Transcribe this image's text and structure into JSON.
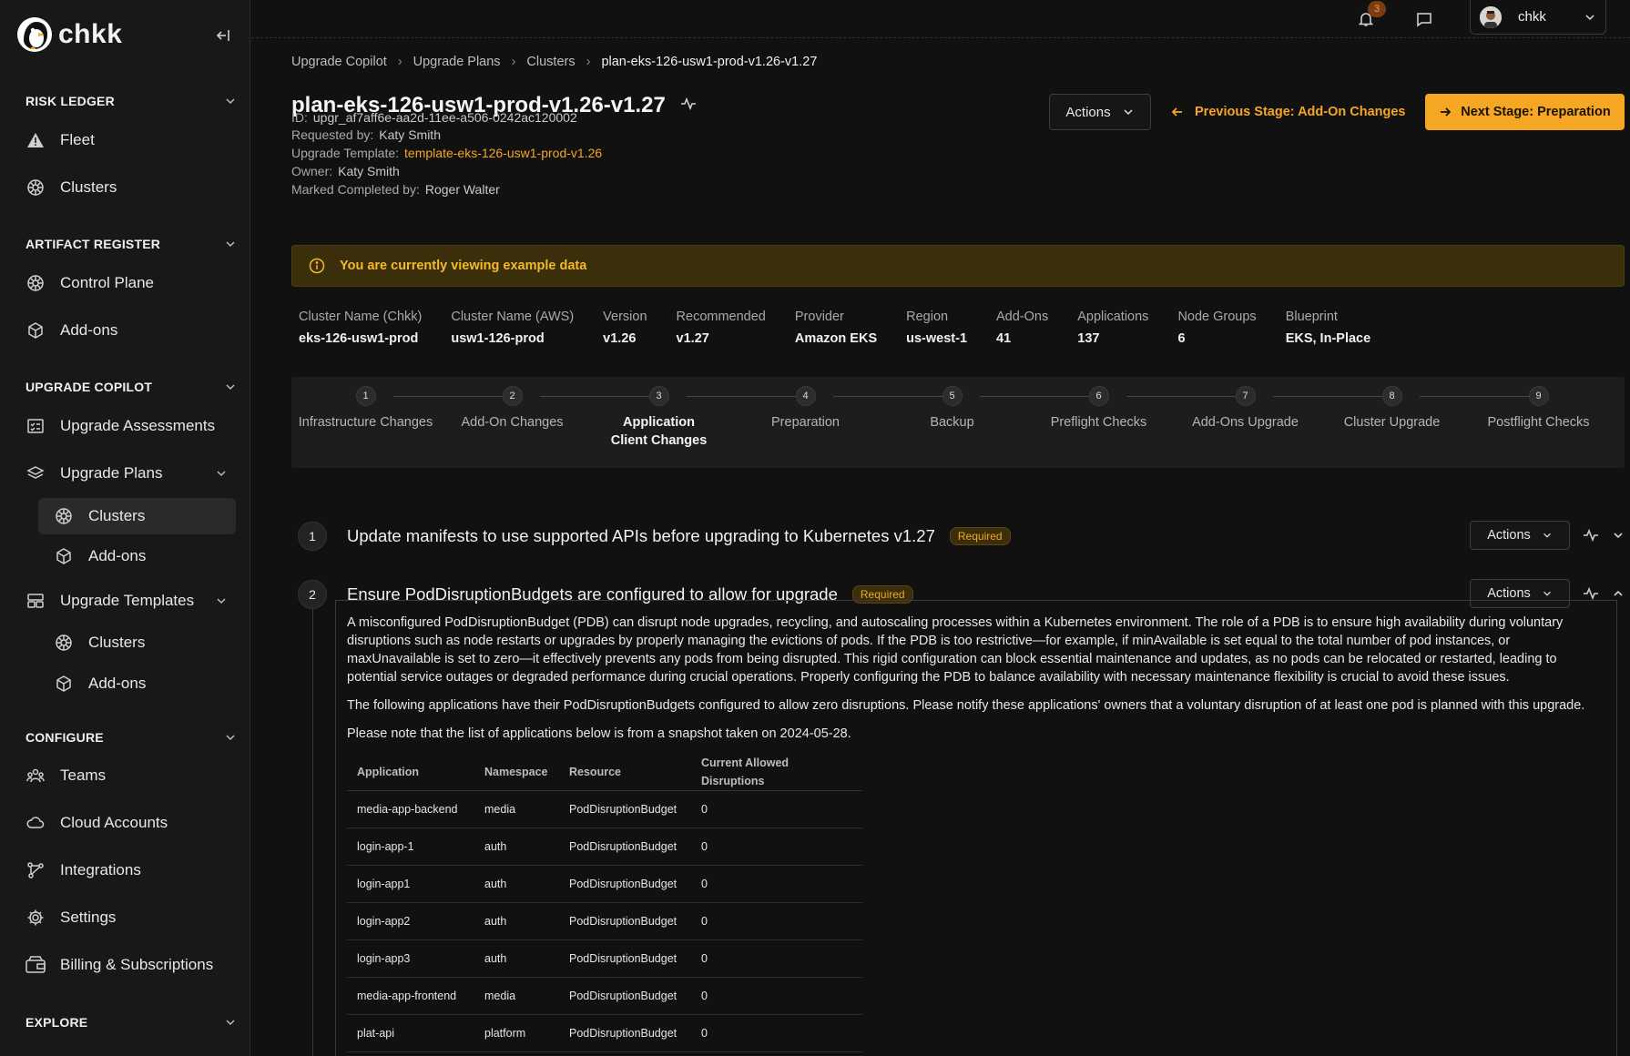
{
  "app": {
    "logo_text": "chkk"
  },
  "sidebar": {
    "sections": {
      "risk_ledger": "RISK LEDGER",
      "artifact_register": "ARTIFACT REGISTER",
      "upgrade_copilot": "UPGRADE COPILOT",
      "configure": "CONFIGURE",
      "explore": "EXPLORE"
    },
    "items": {
      "fleet": "Fleet",
      "clusters": "Clusters",
      "control_plane": "Control Plane",
      "addons": "Add-ons",
      "upgrade_assessments": "Upgrade Assessments",
      "upgrade_plans": "Upgrade Plans",
      "plans_clusters": "Clusters",
      "plans_addons": "Add-ons",
      "upgrade_templates": "Upgrade Templates",
      "templates_clusters": "Clusters",
      "templates_addons": "Add-ons",
      "teams": "Teams",
      "cloud_accounts": "Cloud Accounts",
      "integrations": "Integrations",
      "settings": "Settings",
      "billing": "Billing & Subscriptions"
    }
  },
  "topbar": {
    "notification_count": "3",
    "user_name": "chkk"
  },
  "breadcrumb": [
    "Upgrade Copilot",
    "Upgrade Plans",
    "Clusters",
    "plan-eks-126-usw1-prod-v1.26-v1.27"
  ],
  "page": {
    "title": "plan-eks-126-usw1-prod-v1.26-v1.27",
    "id_label": "ID:",
    "id_value": "upgr_af7aff6e-aa2d-11ee-a506-0242ac120002",
    "requested_label": "Requested by:",
    "requested_value": "Katy Smith",
    "template_label": "Upgrade Template:",
    "template_value": "template-eks-126-usw1-prod-v1.26",
    "owner_label": "Owner:",
    "owner_value": "Katy Smith",
    "completed_label": "Marked Completed by:",
    "completed_value": "Roger Walter",
    "actions_label": "Actions",
    "prev_stage": "Previous Stage: Add-On Changes",
    "next_stage": "Next Stage: Preparation"
  },
  "banner": {
    "text": "You are currently viewing example data"
  },
  "stats": [
    {
      "key": "Cluster Name (Chkk)",
      "value": "eks-126-usw1-prod"
    },
    {
      "key": "Cluster Name (AWS)",
      "value": "usw1-126-prod"
    },
    {
      "key": "Version",
      "value": "v1.26"
    },
    {
      "key": "Recommended",
      "value": "v1.27"
    },
    {
      "key": "Provider",
      "value": "Amazon EKS"
    },
    {
      "key": "Region",
      "value": "us-west-1"
    },
    {
      "key": "Add-Ons",
      "value": "41"
    },
    {
      "key": "Applications",
      "value": "137"
    },
    {
      "key": "Node Groups",
      "value": "6"
    },
    {
      "key": "Blueprint",
      "value": "EKS, In-Place"
    }
  ],
  "steps": [
    {
      "num": "1",
      "label": "Infrastructure Changes"
    },
    {
      "num": "2",
      "label": "Add-On Changes"
    },
    {
      "num": "3",
      "label": "Application Client Changes"
    },
    {
      "num": "4",
      "label": "Preparation"
    },
    {
      "num": "5",
      "label": "Backup"
    },
    {
      "num": "6",
      "label": "Preflight Checks"
    },
    {
      "num": "7",
      "label": "Add-Ons Upgrade"
    },
    {
      "num": "8",
      "label": "Cluster Upgrade"
    },
    {
      "num": "9",
      "label": "Postflight Checks"
    }
  ],
  "tasks": [
    {
      "num": "1",
      "title": "Update manifests to use supported APIs before upgrading to Kubernetes v1.27",
      "badge": "Required",
      "actions": "Actions"
    },
    {
      "num": "2",
      "title": "Ensure PodDisruptionBudgets are configured to allow for upgrade",
      "badge": "Required",
      "actions": "Actions"
    }
  ],
  "detail": {
    "p1": "A misconfigured PodDisruptionBudget (PDB) can disrupt node upgrades, recycling, and autoscaling processes within a Kubernetes environment. The role of a PDB is to ensure high availability during voluntary disruptions such as node restarts or upgrades by properly managing the evictions of pods. If the PDB is too restrictive—for example, if minAvailable is set equal to the total number of pod instances, or maxUnavailable is set to zero—it effectively prevents any pods from being disrupted. This rigid configuration can block essential maintenance and updates, as no pods can be relocated or restarted, leading to potential service outages or degraded performance during crucial operations. Properly configuring the PDB to balance availability with necessary maintenance flexibility is crucial to avoid these issues.",
    "p2": "The following applications have their PodDisruptionBudgets configured to allow zero disruptions. Please notify these applications' owners that a voluntary disruption of at least one pod is planned with this upgrade.",
    "p3": "Please note that the list of applications below is from a snapshot taken on 2024-05-28.",
    "table": {
      "headers": [
        "Application",
        "Namespace",
        "Resource",
        "Current Allowed Disruptions"
      ],
      "rows": [
        [
          "media-app-backend",
          "media",
          "PodDisruptionBudget",
          "0"
        ],
        [
          "login-app-1",
          "auth",
          "PodDisruptionBudget",
          "0"
        ],
        [
          "login-app1",
          "auth",
          "PodDisruptionBudget",
          "0"
        ],
        [
          "login-app2",
          "auth",
          "PodDisruptionBudget",
          "0"
        ],
        [
          "login-app3",
          "auth",
          "PodDisruptionBudget",
          "0"
        ],
        [
          "media-app-frontend",
          "media",
          "PodDisruptionBudget",
          "0"
        ],
        [
          "plat-api",
          "platform",
          "PodDisruptionBudget",
          "0"
        ]
      ]
    }
  },
  "colors": {
    "accent": "#f5a623",
    "background": "#111111",
    "sidebar": "#181818"
  }
}
